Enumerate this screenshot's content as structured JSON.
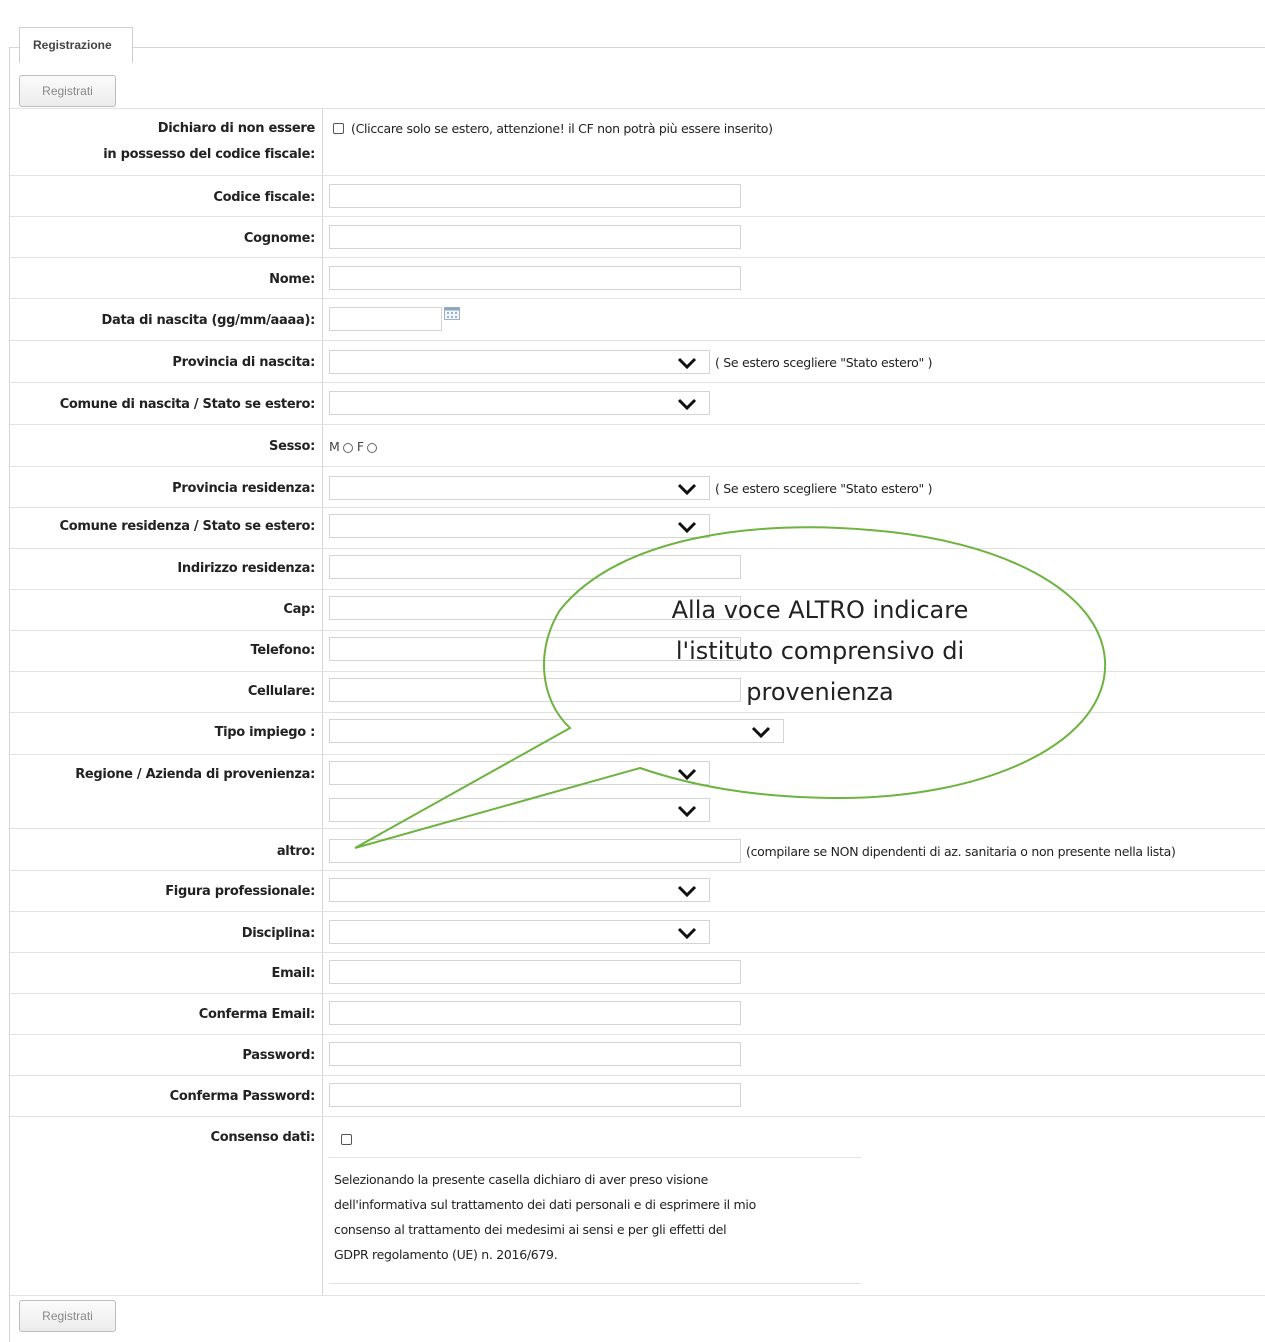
{
  "tab": {
    "label": "Registrazione"
  },
  "buttons": {
    "register_top": "Registrati",
    "register_bottom": "Registrati"
  },
  "fields": {
    "no_cf": {
      "label_line1": "Dichiaro di non essere",
      "label_line2": "in possesso del codice fiscale:",
      "note": "(Cliccare solo se estero, attenzione! il CF non potrà più essere inserito)"
    },
    "codice_fiscale": {
      "label": "Codice fiscale:",
      "value": ""
    },
    "cognome": {
      "label": "Cognome:",
      "value": ""
    },
    "nome": {
      "label": "Nome:",
      "value": ""
    },
    "data_nascita": {
      "label": "Data di nascita (gg/mm/aaaa):",
      "value": ""
    },
    "provincia_nascita": {
      "label": "Provincia di nascita:",
      "value": "",
      "note": "( Se estero scegliere \"Stato estero\" )"
    },
    "comune_nascita": {
      "label": "Comune di nascita / Stato se estero:",
      "value": ""
    },
    "sesso": {
      "label": "Sesso:",
      "option_m": "M",
      "option_f": "F"
    },
    "provincia_residenza": {
      "label": "Provincia residenza:",
      "value": "",
      "note": "( Se estero scegliere \"Stato estero\" )"
    },
    "comune_residenza": {
      "label": "Comune residenza / Stato se estero:",
      "value": ""
    },
    "indirizzo": {
      "label": "Indirizzo residenza:",
      "value": ""
    },
    "cap": {
      "label": "Cap:",
      "value": ""
    },
    "telefono": {
      "label": "Telefono:",
      "value": ""
    },
    "cellulare": {
      "label": "Cellulare:",
      "value": ""
    },
    "tipo_impiego": {
      "label": "Tipo impiego :",
      "value": ""
    },
    "regione": {
      "label": "Regione / Azienda di provenienza:",
      "value": "",
      "second_value": ""
    },
    "altro": {
      "label": "altro:",
      "value": "",
      "note": "(compilare se NON dipendenti di az. sanitaria o non presente nella lista)"
    },
    "figura": {
      "label": "Figura professionale:",
      "value": ""
    },
    "disciplina": {
      "label": "Disciplina:",
      "value": ""
    },
    "email": {
      "label": "Email:",
      "value": ""
    },
    "conferma_email": {
      "label": "Conferma Email:",
      "value": ""
    },
    "password": {
      "label": "Password:",
      "value": ""
    },
    "conferma_password": {
      "label": "Conferma Password:",
      "value": ""
    },
    "consenso": {
      "label": "Consenso dati:",
      "text_line1": "Selezionando la presente casella dichiaro di aver preso visione",
      "text_line2": "dell'informativa sul trattamento dei dati personali e di esprimere il mio",
      "text_line3": "consenso al trattamento dei medesimi ai sensi e per gli effetti del",
      "text_line4": "GDPR regolamento (UE) n. 2016/679."
    }
  },
  "callout": {
    "line1": "Alla voce ALTRO indicare",
    "line2": "l'istituto comprensivo di",
    "line3": "provenienza",
    "stroke_color": "#6db33f"
  },
  "icons": {
    "calendar": "calendar-icon",
    "chevron": "chevron-down-icon"
  }
}
